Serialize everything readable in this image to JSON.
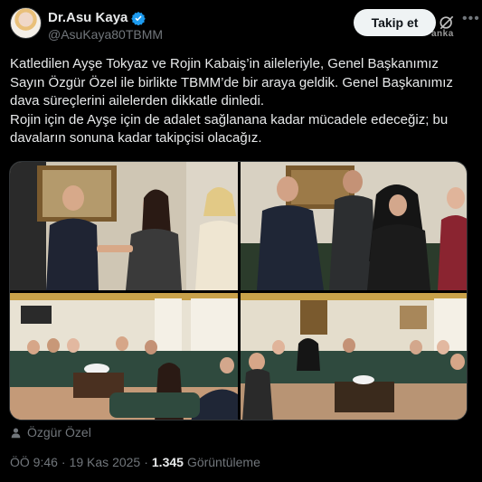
{
  "header": {
    "display_name": "Dr.Asu Kaya",
    "handle": "@AsuKaya80TBMM",
    "follow_label": "Takip et",
    "brand_watermark": "anka"
  },
  "tweet": {
    "paragraph_1": "Katledilen Ayşe Tokyaz ve Rojin Kabaiş’in aileleriyle, Genel Başkanımız Sayın Özgür Özel ile birlikte TBMM’de bir araya geldik. Genel Başkanımız dava süreçlerini ailelerden dikkatle dinledi.",
    "paragraph_2": "Rojin için de Ayşe için de adalet sağlanana kadar mücadele edeceğiz; bu davaların sonuna kadar takipçisi olacağız."
  },
  "media": {
    "photos": [
      {
        "id": "photo-1"
      },
      {
        "id": "photo-2"
      },
      {
        "id": "photo-3"
      },
      {
        "id": "photo-4"
      }
    ]
  },
  "tagged": {
    "name": "Özgür Özel"
  },
  "meta": {
    "time": "ÖÖ 9:46",
    "separator": "·",
    "date": "19 Kas 2025",
    "views_count": "1.345",
    "views_label": "Görüntüleme"
  },
  "colors": {
    "background": "#000000",
    "text": "#e7e9ea",
    "muted": "#71767b",
    "verified": "#1d9bf0",
    "follow_bg": "#eff3f4"
  },
  "icons": {
    "verified": "verified-badge-icon",
    "grok": "grok-icon",
    "more": "more-options-icon",
    "person": "person-icon"
  }
}
